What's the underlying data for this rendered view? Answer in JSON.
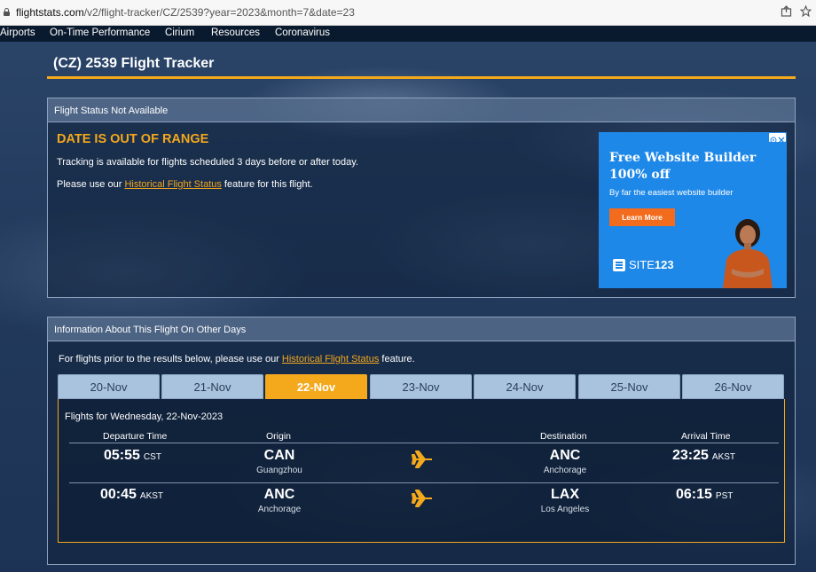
{
  "browser": {
    "url_host": "flightstats.com",
    "url_path": "/v2/flight-tracker/CZ/2539?year=2023&month=7&date=23",
    "share_icon": "share-icon",
    "bookmark_icon": "star-icon"
  },
  "nav": {
    "items": [
      "Airports",
      "On-Time Performance",
      "Cirium",
      "Resources",
      "Coronavirus"
    ]
  },
  "page": {
    "title": "(CZ) 2539 Flight Tracker"
  },
  "status_panel": {
    "header": "Flight Status Not Available",
    "error_title": "DATE IS OUT OF RANGE",
    "message": "Tracking is available for flights scheduled 3 days before or after today.",
    "hint_prefix": "Please use our ",
    "hint_link": "Historical Flight Status",
    "hint_suffix": " feature for this flight."
  },
  "ad": {
    "headline1": "Free Website Builder",
    "headline2": "100% off",
    "subtext": "By far the easiest website builder",
    "button": "Learn More",
    "brand_prefix": "SITE",
    "brand_suffix": "123"
  },
  "other_days_panel": {
    "header": "Information About This Flight On Other Days",
    "note_prefix": "For flights prior to the results below, please use our ",
    "note_link": "Historical Flight Status",
    "note_suffix": " feature.",
    "tabs": [
      "20-Nov",
      "21-Nov",
      "22-Nov",
      "23-Nov",
      "24-Nov",
      "25-Nov",
      "26-Nov"
    ],
    "active_tab": "22-Nov",
    "flights_for": "Flights for Wednesday, 22-Nov-2023",
    "columns": {
      "departure": "Departure Time",
      "origin": "Origin",
      "destination": "Destination",
      "arrival": "Arrival Time"
    },
    "flights": [
      {
        "dep_time": "05:55",
        "dep_tz": "CST",
        "origin_code": "CAN",
        "origin_city": "Guangzhou",
        "dest_code": "ANC",
        "dest_city": "Anchorage",
        "arr_time": "23:25",
        "arr_tz": "AKST"
      },
      {
        "dep_time": "00:45",
        "dep_tz": "AKST",
        "origin_code": "ANC",
        "origin_city": "Anchorage",
        "dest_code": "LAX",
        "dest_city": "Los Angeles",
        "arr_time": "06:15",
        "arr_tz": "PST"
      }
    ]
  },
  "colors": {
    "accent": "#f4a81c",
    "tab_inactive": "#a9c3df",
    "ad_blue": "#1e88e8",
    "ad_button": "#f36b1c"
  }
}
